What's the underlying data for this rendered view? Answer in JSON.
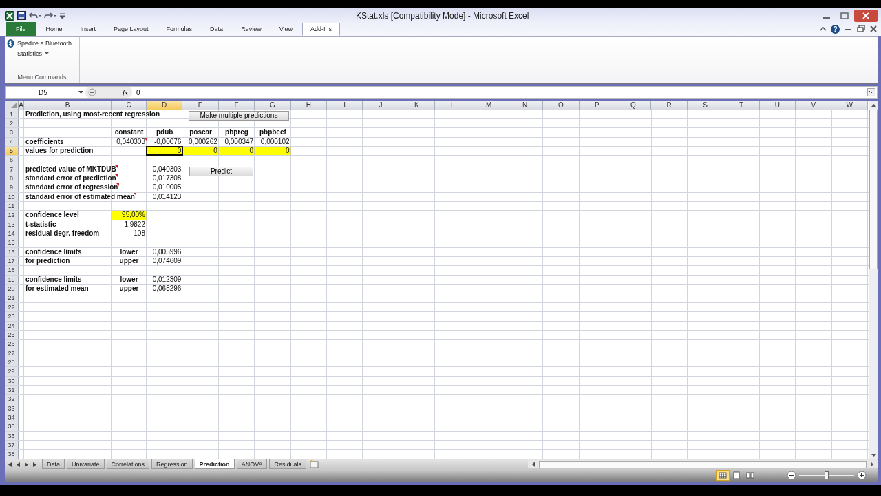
{
  "window": {
    "title": "KStat.xls  [Compatibility Mode]  -  Microsoft Excel"
  },
  "ribbon_tabs": [
    {
      "label": "File",
      "kind": "file",
      "selected": false
    },
    {
      "label": "Home",
      "kind": "tab",
      "selected": false
    },
    {
      "label": "Insert",
      "kind": "tab",
      "selected": false
    },
    {
      "label": "Page Layout",
      "kind": "tab",
      "selected": false
    },
    {
      "label": "Formulas",
      "kind": "tab",
      "selected": false
    },
    {
      "label": "Data",
      "kind": "tab",
      "selected": false
    },
    {
      "label": "Review",
      "kind": "tab",
      "selected": false
    },
    {
      "label": "View",
      "kind": "tab",
      "selected": false
    },
    {
      "label": "Add-Ins",
      "kind": "tab",
      "selected": true
    }
  ],
  "help_button": "?",
  "ribbon_group": {
    "items": [
      {
        "label": "Spedire a Bluetooth",
        "kind": "bluetooth"
      },
      {
        "label": "Statistics",
        "kind": "menu"
      }
    ],
    "label": "Menu Commands"
  },
  "formula_bar": {
    "name_box": "D5",
    "function_label": "fx",
    "value": "0"
  },
  "columns": [
    {
      "label": "A",
      "selected": false
    },
    {
      "label": "B",
      "selected": false
    },
    {
      "label": "C",
      "selected": false
    },
    {
      "label": "D",
      "selected": true
    },
    {
      "label": "E",
      "selected": false
    },
    {
      "label": "F",
      "selected": false
    },
    {
      "label": "G",
      "selected": false
    },
    {
      "label": "H",
      "selected": false
    },
    {
      "label": "I",
      "selected": false
    },
    {
      "label": "J",
      "selected": false
    },
    {
      "label": "K",
      "selected": false
    },
    {
      "label": "L",
      "selected": false
    },
    {
      "label": "M",
      "selected": false
    },
    {
      "label": "N",
      "selected": false
    },
    {
      "label": "O",
      "selected": false
    },
    {
      "label": "P",
      "selected": false
    },
    {
      "label": "Q",
      "selected": false
    },
    {
      "label": "R",
      "selected": false
    },
    {
      "label": "S",
      "selected": false
    },
    {
      "label": "T",
      "selected": false
    },
    {
      "label": "U",
      "selected": false
    },
    {
      "label": "V",
      "selected": false
    },
    {
      "label": "W",
      "selected": false
    }
  ],
  "rows": [
    {
      "number": "1",
      "selected": false,
      "cells": [
        null,
        {
          "text": "Prediction, using most-recent regression",
          "kind": "label",
          "highlight": false,
          "selected": false,
          "comment": false
        }
      ]
    },
    {
      "number": "2",
      "selected": false
    },
    {
      "number": "3",
      "selected": false,
      "cells": [
        null,
        null,
        {
          "text": "constant",
          "kind": "heading",
          "highlight": false,
          "selected": false,
          "comment": false
        },
        {
          "text": "pdub",
          "kind": "heading",
          "highlight": false,
          "selected": false,
          "comment": false
        },
        {
          "text": "poscar",
          "kind": "heading",
          "highlight": false,
          "selected": false,
          "comment": false
        },
        {
          "text": "pbpreg",
          "kind": "heading",
          "highlight": false,
          "selected": false,
          "comment": false
        },
        {
          "text": "pbpbeef",
          "kind": "heading",
          "highlight": false,
          "selected": false,
          "comment": false
        }
      ]
    },
    {
      "number": "4",
      "selected": false,
      "cells": [
        null,
        {
          "text": "coefficients",
          "kind": "label",
          "highlight": false,
          "selected": false,
          "comment": false
        },
        {
          "text": "0,040303",
          "kind": "number",
          "highlight": false,
          "selected": false,
          "comment": true
        },
        {
          "text": "-0,00076",
          "kind": "number",
          "highlight": false,
          "selected": false,
          "comment": false
        },
        {
          "text": "0,000262",
          "kind": "number",
          "highlight": false,
          "selected": false,
          "comment": false
        },
        {
          "text": "0,000347",
          "kind": "number",
          "highlight": false,
          "selected": false,
          "comment": false
        },
        {
          "text": "0,000102",
          "kind": "number",
          "highlight": false,
          "selected": false,
          "comment": false
        }
      ]
    },
    {
      "number": "5",
      "selected": true,
      "cells": [
        null,
        {
          "text": "values for prediction",
          "kind": "label",
          "highlight": false,
          "selected": false,
          "comment": false
        },
        null,
        {
          "text": "0",
          "kind": "number",
          "highlight": true,
          "selected": true,
          "comment": false
        },
        {
          "text": "0",
          "kind": "number",
          "highlight": true,
          "selected": false,
          "comment": false
        },
        {
          "text": "0",
          "kind": "number",
          "highlight": true,
          "selected": false,
          "comment": false
        },
        {
          "text": "0",
          "kind": "number",
          "highlight": true,
          "selected": false,
          "comment": false
        }
      ]
    },
    {
      "number": "6",
      "selected": false
    },
    {
      "number": "7",
      "selected": false,
      "cells": [
        null,
        {
          "text": "predicted value of MKTDUB",
          "kind": "label",
          "highlight": false,
          "selected": false,
          "comment": true
        },
        null,
        {
          "text": "0,040303",
          "kind": "number",
          "highlight": false,
          "selected": false,
          "comment": false
        }
      ]
    },
    {
      "number": "8",
      "selected": false,
      "cells": [
        null,
        {
          "text": "standard error of prediction",
          "kind": "label",
          "highlight": false,
          "selected": false,
          "comment": true
        },
        null,
        {
          "text": "0,017308",
          "kind": "number",
          "highlight": false,
          "selected": false,
          "comment": false
        }
      ]
    },
    {
      "number": "9",
      "selected": false,
      "cells": [
        null,
        {
          "text": "standard error of regression",
          "kind": "label",
          "highlight": false,
          "selected": false,
          "comment": true
        },
        null,
        {
          "text": "0,010005",
          "kind": "number",
          "highlight": false,
          "selected": false,
          "comment": false
        }
      ]
    },
    {
      "number": "10",
      "selected": false,
      "cells": [
        null,
        {
          "text": "standard error of estimated mean",
          "kind": "label",
          "highlight": false,
          "selected": false,
          "comment": true
        },
        null,
        {
          "text": "0,014123",
          "kind": "number",
          "highlight": false,
          "selected": false,
          "comment": false
        }
      ]
    },
    {
      "number": "11",
      "selected": false
    },
    {
      "number": "12",
      "selected": false,
      "cells": [
        null,
        {
          "text": "confidence level",
          "kind": "label",
          "highlight": false,
          "selected": false,
          "comment": false
        },
        {
          "text": "95,00%",
          "kind": "number",
          "highlight": true,
          "selected": false,
          "comment": false
        }
      ]
    },
    {
      "number": "13",
      "selected": false,
      "cells": [
        null,
        {
          "text": " t-statistic",
          "kind": "label",
          "highlight": false,
          "selected": false,
          "comment": false
        },
        {
          "text": "1,9822",
          "kind": "number",
          "highlight": false,
          "selected": false,
          "comment": false
        }
      ]
    },
    {
      "number": "14",
      "selected": false,
      "cells": [
        null,
        {
          "text": "residual degr. freedom",
          "kind": "label",
          "highlight": false,
          "selected": false,
          "comment": false
        },
        {
          "text": "108",
          "kind": "number",
          "highlight": false,
          "selected": false,
          "comment": false
        }
      ]
    },
    {
      "number": "15",
      "selected": false
    },
    {
      "number": "16",
      "selected": false,
      "cells": [
        null,
        {
          "text": "confidence limits",
          "kind": "label",
          "highlight": false,
          "selected": false,
          "comment": false
        },
        {
          "text": "lower",
          "kind": "heading",
          "highlight": false,
          "selected": false,
          "comment": false
        },
        {
          "text": "0,005996",
          "kind": "number",
          "highlight": false,
          "selected": false,
          "comment": false
        }
      ]
    },
    {
      "number": "17",
      "selected": false,
      "cells": [
        null,
        {
          "text": "for prediction",
          "kind": "label",
          "highlight": false,
          "selected": false,
          "comment": false
        },
        {
          "text": "upper",
          "kind": "heading",
          "highlight": false,
          "selected": false,
          "comment": false
        },
        {
          "text": "0,074609",
          "kind": "number",
          "highlight": false,
          "selected": false,
          "comment": false
        }
      ]
    },
    {
      "number": "18",
      "selected": false
    },
    {
      "number": "19",
      "selected": false,
      "cells": [
        null,
        {
          "text": "confidence limits",
          "kind": "label",
          "highlight": false,
          "selected": false,
          "comment": false
        },
        {
          "text": "lower",
          "kind": "heading",
          "highlight": false,
          "selected": false,
          "comment": false
        },
        {
          "text": "0,012309",
          "kind": "number",
          "highlight": false,
          "selected": false,
          "comment": false
        }
      ]
    },
    {
      "number": "20",
      "selected": false,
      "cells": [
        null,
        {
          "text": "for estimated mean",
          "kind": "label",
          "highlight": false,
          "selected": false,
          "comment": false
        },
        {
          "text": "upper",
          "kind": "heading",
          "highlight": false,
          "selected": false,
          "comment": false
        },
        {
          "text": "0,068296",
          "kind": "number",
          "highlight": false,
          "selected": false,
          "comment": false
        }
      ]
    },
    {
      "number": "21",
      "selected": false
    },
    {
      "number": "22",
      "selected": false
    },
    {
      "number": "23",
      "selected": false
    },
    {
      "number": "24",
      "selected": false
    },
    {
      "number": "25",
      "selected": false
    },
    {
      "number": "26",
      "selected": false
    },
    {
      "number": "27",
      "selected": false
    },
    {
      "number": "28",
      "selected": false
    },
    {
      "number": "29",
      "selected": false
    },
    {
      "number": "30",
      "selected": false
    },
    {
      "number": "31",
      "selected": false
    },
    {
      "number": "32",
      "selected": false
    },
    {
      "number": "33",
      "selected": false
    },
    {
      "number": "34",
      "selected": false
    },
    {
      "number": "35",
      "selected": false
    },
    {
      "number": "36",
      "selected": false
    },
    {
      "number": "37",
      "selected": false
    },
    {
      "number": "38",
      "selected": false
    }
  ],
  "sheet_buttons": [
    {
      "label": "Make multiple predictions"
    },
    {
      "label": "Predict"
    }
  ],
  "sheet_tabs": [
    {
      "label": "Data",
      "selected": false
    },
    {
      "label": "Univariate",
      "selected": false
    },
    {
      "label": "Correlations",
      "selected": false
    },
    {
      "label": "Regression",
      "selected": false
    },
    {
      "label": "Prediction",
      "selected": true
    },
    {
      "label": "ANOVA",
      "selected": false
    },
    {
      "label": "Residuals",
      "selected": false
    }
  ],
  "status_bar": {
    "views": [
      {
        "kind": "normal",
        "selected": true
      },
      {
        "kind": "layout",
        "selected": false
      },
      {
        "kind": "break",
        "selected": false
      }
    ],
    "zoom": {
      "level": 0.5
    }
  }
}
